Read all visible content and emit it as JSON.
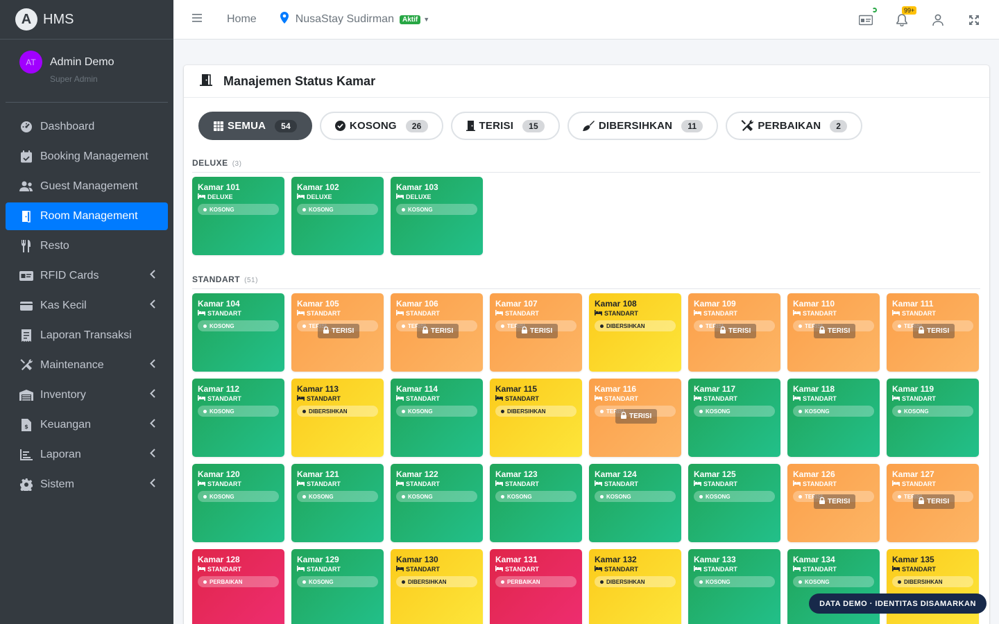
{
  "brand": {
    "initial": "A",
    "name": "HMS"
  },
  "user": {
    "initials": "AT",
    "name": "Admin Demo",
    "role": "Super Admin"
  },
  "nav": [
    {
      "label": "Dashboard",
      "icon": "tachometer-icon",
      "active": false,
      "arrow": false
    },
    {
      "label": "Booking Management",
      "icon": "calendar-check-icon",
      "active": false,
      "arrow": false
    },
    {
      "label": "Guest Management",
      "icon": "users-icon",
      "active": false,
      "arrow": false
    },
    {
      "label": "Room Management",
      "icon": "door-open-icon",
      "active": true,
      "arrow": false
    },
    {
      "label": "Resto",
      "icon": "utensils-icon",
      "active": false,
      "arrow": false
    },
    {
      "label": "RFID Cards",
      "icon": "id-card-icon",
      "active": false,
      "arrow": true
    },
    {
      "label": "Kas Kecil",
      "icon": "wallet-icon",
      "active": false,
      "arrow": true
    },
    {
      "label": "Laporan Transaksi",
      "icon": "receipt-icon",
      "active": false,
      "arrow": false
    },
    {
      "label": "Maintenance",
      "icon": "tools-icon",
      "active": false,
      "arrow": true
    },
    {
      "label": "Inventory",
      "icon": "warehouse-icon",
      "active": false,
      "arrow": true
    },
    {
      "label": "Keuangan",
      "icon": "invoice-dollar-icon",
      "active": false,
      "arrow": true
    },
    {
      "label": "Laporan",
      "icon": "chart-line-icon",
      "active": false,
      "arrow": true
    },
    {
      "label": "Sistem",
      "icon": "cog-icon",
      "active": false,
      "arrow": true
    }
  ],
  "topbar": {
    "home_label": "Home",
    "hotel_name": "NusaStay Sudirman",
    "hotel_status": "Aktif",
    "notif_count": "99+"
  },
  "card": {
    "title": "Manajemen Status Kamar"
  },
  "filters": [
    {
      "label": "SEMUA",
      "count": "54",
      "icon": "grid-icon",
      "active": true
    },
    {
      "label": "KOSONG",
      "count": "26",
      "icon": "check-circle-icon",
      "active": false
    },
    {
      "label": "TERISI",
      "count": "15",
      "icon": "door-closed-icon",
      "active": false
    },
    {
      "label": "DIBERSIHKAN",
      "count": "11",
      "icon": "broom-icon",
      "active": false
    },
    {
      "label": "PERBAIKAN",
      "count": "2",
      "icon": "tools-icon",
      "active": false
    }
  ],
  "groups": [
    {
      "title": "DELUXE",
      "count": "(3)",
      "rooms": [
        {
          "name": "Kamar 101",
          "type": "DELUXE",
          "status": "kosong",
          "status_label": "KOSONG"
        },
        {
          "name": "Kamar 102",
          "type": "DELUXE",
          "status": "kosong",
          "status_label": "KOSONG"
        },
        {
          "name": "Kamar 103",
          "type": "DELUXE",
          "status": "kosong",
          "status_label": "KOSONG"
        }
      ]
    },
    {
      "title": "STANDART",
      "count": "(51)",
      "rooms": [
        {
          "name": "Kamar 104",
          "type": "STANDART",
          "status": "kosong",
          "status_label": "KOSONG"
        },
        {
          "name": "Kamar 105",
          "type": "STANDART",
          "status": "terisi",
          "status_label": "TERISI"
        },
        {
          "name": "Kamar 106",
          "type": "STANDART",
          "status": "terisi",
          "status_label": "TERISI"
        },
        {
          "name": "Kamar 107",
          "type": "STANDART",
          "status": "terisi",
          "status_label": "TERISI"
        },
        {
          "name": "Kamar 108",
          "type": "STANDART",
          "status": "dibersihkan",
          "status_label": "DIBERSIHKAN"
        },
        {
          "name": "Kamar 109",
          "type": "STANDART",
          "status": "terisi",
          "status_label": "TERISI"
        },
        {
          "name": "Kamar 110",
          "type": "STANDART",
          "status": "terisi",
          "status_label": "TERISI"
        },
        {
          "name": "Kamar 111",
          "type": "STANDART",
          "status": "terisi",
          "status_label": "TERISI"
        },
        {
          "name": "Kamar 112",
          "type": "STANDART",
          "status": "kosong",
          "status_label": "KOSONG"
        },
        {
          "name": "Kamar 113",
          "type": "STANDART",
          "status": "dibersihkan",
          "status_label": "DIBERSIHKAN"
        },
        {
          "name": "Kamar 114",
          "type": "STANDART",
          "status": "kosong",
          "status_label": "KOSONG"
        },
        {
          "name": "Kamar 115",
          "type": "STANDART",
          "status": "dibersihkan",
          "status_label": "DIBERSIHKAN"
        },
        {
          "name": "Kamar 116",
          "type": "STANDART",
          "status": "terisi",
          "status_label": "TERISI"
        },
        {
          "name": "Kamar 117",
          "type": "STANDART",
          "status": "kosong",
          "status_label": "KOSONG"
        },
        {
          "name": "Kamar 118",
          "type": "STANDART",
          "status": "kosong",
          "status_label": "KOSONG"
        },
        {
          "name": "Kamar 119",
          "type": "STANDART",
          "status": "kosong",
          "status_label": "KOSONG"
        },
        {
          "name": "Kamar 120",
          "type": "STANDART",
          "status": "kosong",
          "status_label": "KOSONG"
        },
        {
          "name": "Kamar 121",
          "type": "STANDART",
          "status": "kosong",
          "status_label": "KOSONG"
        },
        {
          "name": "Kamar 122",
          "type": "STANDART",
          "status": "kosong",
          "status_label": "KOSONG"
        },
        {
          "name": "Kamar 123",
          "type": "STANDART",
          "status": "kosong",
          "status_label": "KOSONG"
        },
        {
          "name": "Kamar 124",
          "type": "STANDART",
          "status": "kosong",
          "status_label": "KOSONG"
        },
        {
          "name": "Kamar 125",
          "type": "STANDART",
          "status": "kosong",
          "status_label": "KOSONG"
        },
        {
          "name": "Kamar 126",
          "type": "STANDART",
          "status": "terisi",
          "status_label": "TERISI"
        },
        {
          "name": "Kamar 127",
          "type": "STANDART",
          "status": "terisi",
          "status_label": "TERISI"
        },
        {
          "name": "Kamar 128",
          "type": "STANDART",
          "status": "perbaikan",
          "status_label": "PERBAIKAN"
        },
        {
          "name": "Kamar 129",
          "type": "STANDART",
          "status": "kosong",
          "status_label": "KOSONG"
        },
        {
          "name": "Kamar 130",
          "type": "STANDART",
          "status": "dibersihkan",
          "status_label": "DIBERSIHKAN"
        },
        {
          "name": "Kamar 131",
          "type": "STANDART",
          "status": "perbaikan",
          "status_label": "PERBAIKAN"
        },
        {
          "name": "Kamar 132",
          "type": "STANDART",
          "status": "dibersihkan",
          "status_label": "DIBERSIHKAN"
        },
        {
          "name": "Kamar 133",
          "type": "STANDART",
          "status": "kosong",
          "status_label": "KOSONG"
        },
        {
          "name": "Kamar 134",
          "type": "STANDART",
          "status": "kosong",
          "status_label": "KOSONG"
        },
        {
          "name": "Kamar 135",
          "type": "STANDART",
          "status": "dibersihkan",
          "status_label": "DIBERSIHKAN"
        }
      ]
    }
  ],
  "lock_label": "TERISI",
  "demo_banner": "DATA DEMO · IDENTITAS DISAMARKAN",
  "colors": {
    "sidebar": "#343a40",
    "primary": "#007bff",
    "kosong": "#21b06d",
    "terisi": "#fca855",
    "dibersihkan": "#fcd72a",
    "perbaikan": "#e6295a"
  }
}
